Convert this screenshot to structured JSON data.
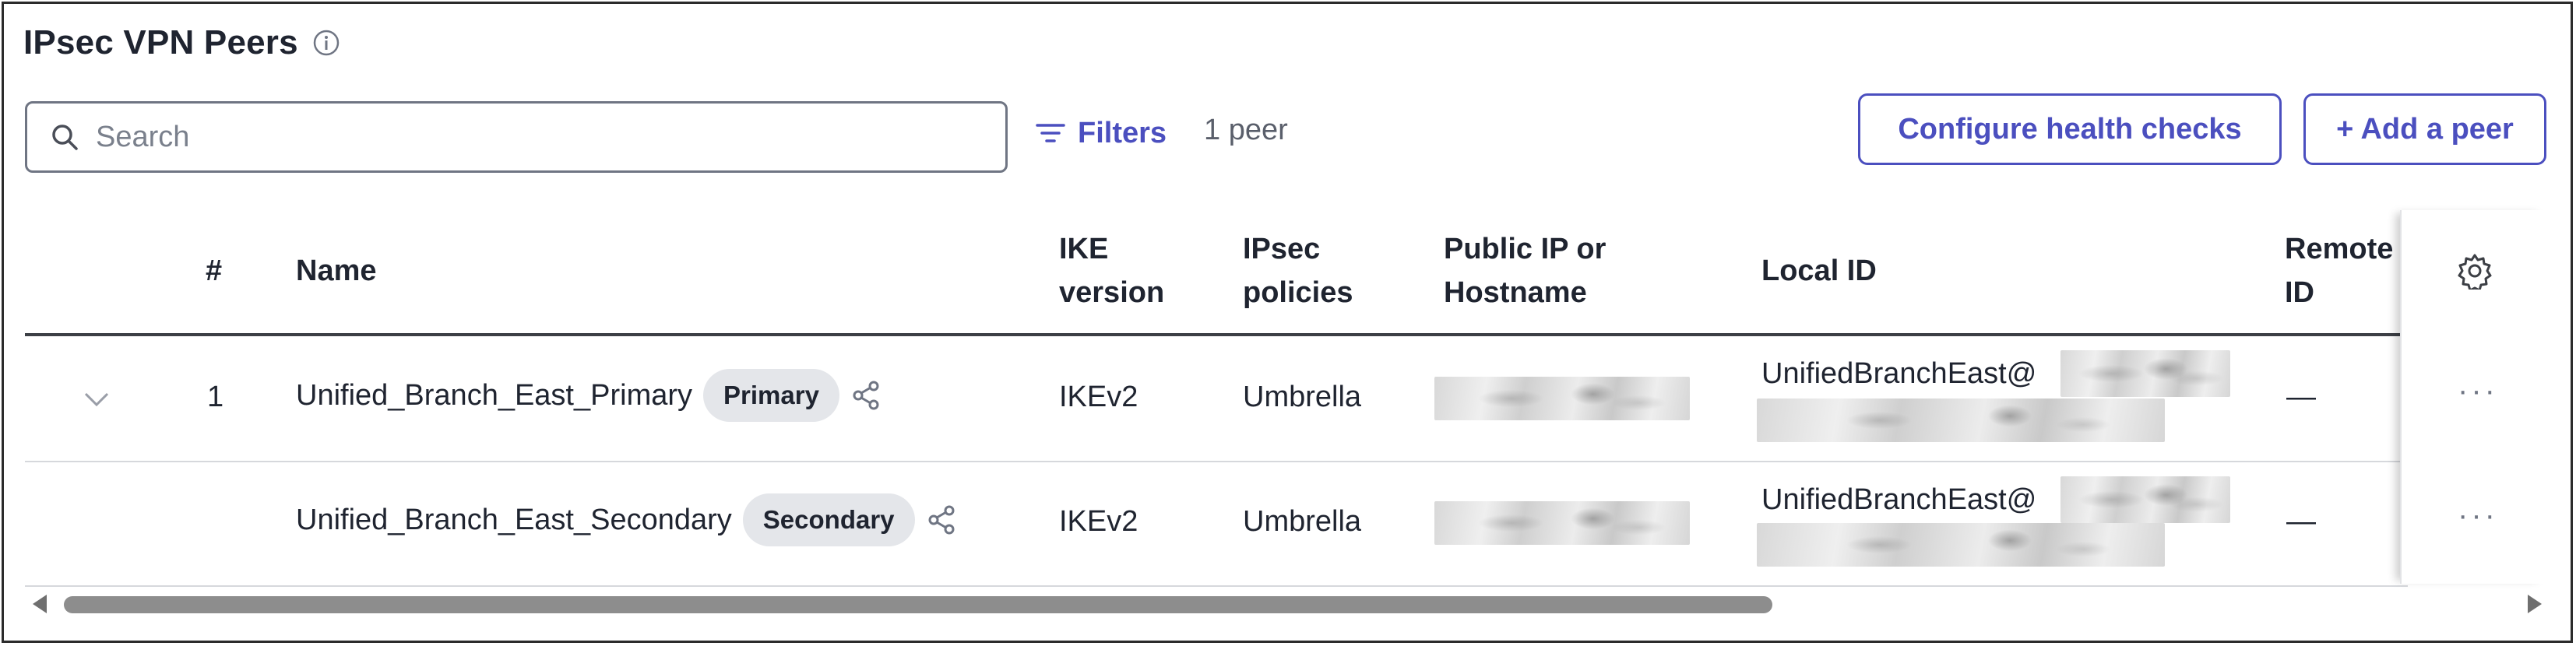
{
  "page": {
    "title": "IPsec VPN Peers"
  },
  "toolbar": {
    "search_placeholder": "Search",
    "filters_label": "Filters",
    "peer_count": "1 peer",
    "configure_health_label": "Configure health checks",
    "add_peer_label": "+ Add a peer"
  },
  "table": {
    "headers": {
      "index": "#",
      "name": "Name",
      "ike_line1": "IKE",
      "ike_line2": "version",
      "ipsec_line1": "IPsec",
      "ipsec_line2": "policies",
      "public_line1": "Public IP or",
      "public_line2": "Hostname",
      "local_id": "Local ID",
      "remote_line1": "Remote",
      "remote_line2": "ID"
    },
    "rows": [
      {
        "index": "1",
        "name": "Unified_Branch_East_Primary",
        "badge": "Primary",
        "ike_version": "IKEv2",
        "ipsec_policy": "Umbrella",
        "local_id_prefix": "UnifiedBranchEast@",
        "remote_id": "—",
        "more": "···"
      },
      {
        "index": "",
        "name": "Unified_Branch_East_Secondary",
        "badge": "Secondary",
        "ike_version": "IKEv2",
        "ipsec_policy": "Umbrella",
        "local_id_prefix": "UnifiedBranchEast@",
        "remote_id": "—",
        "more": "···"
      }
    ]
  },
  "colors": {
    "accent": "#4b4fbf",
    "text": "#1f2430",
    "badge_bg": "#e4e6ea"
  },
  "icons": [
    "info-icon",
    "search-icon",
    "filter-icon",
    "chevron-down-icon",
    "share-icon",
    "gear-icon",
    "more-icon"
  ]
}
